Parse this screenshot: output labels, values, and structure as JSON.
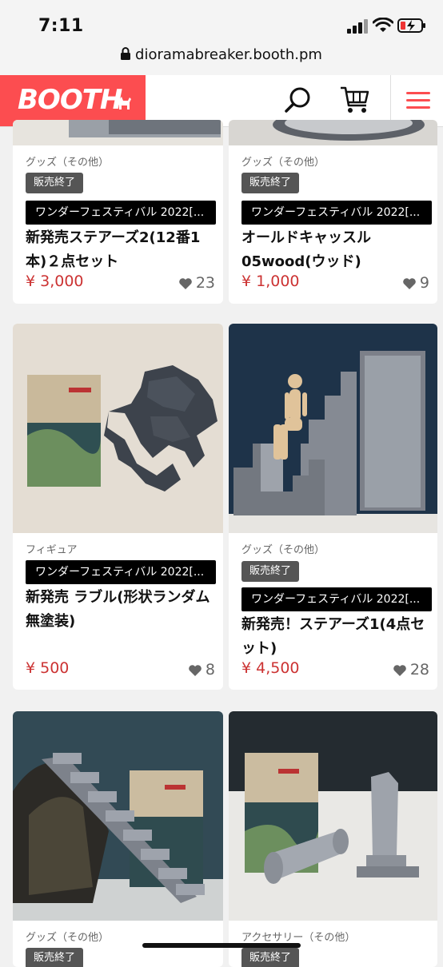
{
  "status": {
    "time": "7:11"
  },
  "browser": {
    "url": "dioramabreaker.booth.pm"
  },
  "header": {
    "logo": "BOOTH"
  },
  "items": [
    {
      "category": "グッズ（その他）",
      "sold_out": "販売終了",
      "event": "ワンダーフェスティバル 2022[...",
      "title": "新発売ステアーズ2(12番1本)２点セット",
      "price": "¥ 3,000",
      "likes": "23"
    },
    {
      "category": "グッズ（その他）",
      "sold_out": "販売終了",
      "event": "ワンダーフェスティバル 2022[...",
      "title": "オールドキャッスル05wood(ウッド)",
      "price": "¥ 1,000",
      "likes": "9"
    },
    {
      "category": "フィギュア",
      "event": "ワンダーフェスティバル 2022[...",
      "title": "新発売 ラブル(形状ランダム無塗装)",
      "price": "¥ 500",
      "likes": "8"
    },
    {
      "category": "グッズ（その他）",
      "sold_out": "販売終了",
      "event": "ワンダーフェスティバル 2022[...",
      "title": "新発売！ステアーズ1(4点セット)",
      "price": "¥ 4,500",
      "likes": "28"
    },
    {
      "category": "グッズ（その他）",
      "sold_out": "販売終了"
    },
    {
      "category": "アクセサリー（その他）",
      "sold_out": "販売終了"
    }
  ]
}
